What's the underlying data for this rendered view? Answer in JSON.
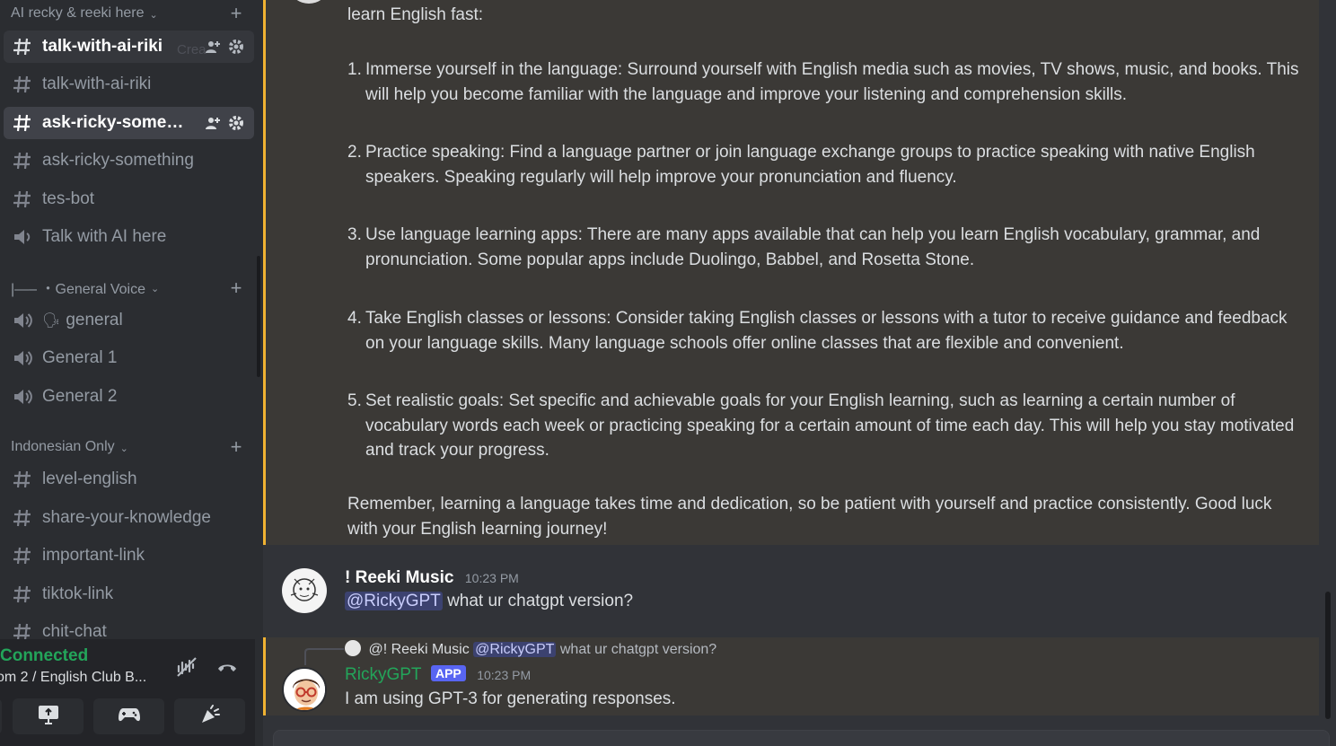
{
  "sidebar": {
    "category_ai": {
      "label": "AI recky & reeki here"
    },
    "ghost_text": "Crea",
    "channels_ai": [
      {
        "label": "talk-with-ai-riki",
        "icon": "text-channel-thread-icon"
      },
      {
        "label": "talk-with-ai-riki",
        "icon": "text-channel-icon"
      },
      {
        "label": "ask-ricky-somet...",
        "icon": "text-channel-thread-icon"
      },
      {
        "label": "ask-ricky-something",
        "icon": "text-channel-icon"
      },
      {
        "label": "tes-bot",
        "icon": "text-channel-thread-icon"
      },
      {
        "label": "Talk with AI here",
        "icon": "stage-channel-icon"
      }
    ],
    "category_voice": {
      "label": "|—– ・General Voice"
    },
    "channels_voice": [
      {
        "label": "general",
        "icon": "speaker-icon",
        "emoji": "🗣"
      },
      {
        "label": "General 1",
        "icon": "speaker-icon"
      },
      {
        "label": "General 2",
        "icon": "speaker-icon"
      }
    ],
    "category_indonesian": {
      "label": "Indonesian Only"
    },
    "channels_indonesian": [
      {
        "label": "level-english",
        "icon": "text-channel-thread-icon"
      },
      {
        "label": "share-your-knowledge",
        "icon": "text-channel-thread-icon"
      },
      {
        "label": "important-link",
        "icon": "text-channel-thread-icon"
      },
      {
        "label": "tiktok-link",
        "icon": "text-channel-icon"
      },
      {
        "label": "chit-chat",
        "icon": "text-channel-thread-icon"
      }
    ]
  },
  "voice_panel": {
    "status": "Connected",
    "room": "om 2 / English Club B..."
  },
  "messages": {
    "bot_reply": {
      "intro": "learn English fast:",
      "items": [
        {
          "n": "1.",
          "text": "Immerse yourself in the language: Surround yourself with English media such as movies, TV shows, music, and books. This will help you become familiar with the language and improve your listening and comprehension skills."
        },
        {
          "n": "2.",
          "text": "Practice speaking: Find a language partner or join language exchange groups to practice speaking with native English speakers. Speaking regularly will help improve your pronunciation and fluency."
        },
        {
          "n": "3.",
          "text": "Use language learning apps: There are many apps available that can help you learn English vocabulary, grammar, and pronunciation. Some popular apps include Duolingo, Babbel, and Rosetta Stone."
        },
        {
          "n": "4.",
          "text": "Take English classes or lessons: Consider taking English classes or lessons with a tutor to receive guidance and feedback on your language skills. Many language schools offer online classes that are flexible and convenient."
        },
        {
          "n": "5.",
          "text": "Set realistic goals: Set specific and achievable goals for your English learning, such as learning a certain number of vocabulary words each week or practicing speaking for a certain amount of time each day. This will help you stay motivated and track your progress."
        }
      ],
      "outro": "Remember, learning a language takes time and dedication, so be patient with yourself and practice consistently. Good luck with your English learning journey!"
    },
    "user_msg": {
      "author": "! Reeki Music",
      "time": "10:23 PM",
      "mention": "@RickyGPT",
      "text": "what ur chatgpt version?"
    },
    "bot_msg": {
      "reply_author": "@! Reeki Music",
      "reply_mention": "@RickyGPT",
      "reply_text": "what ur chatgpt version?",
      "author": "RickyGPT",
      "tag": "APP",
      "time": "10:23 PM",
      "text": "I am using GPT-3 for generating responses."
    }
  },
  "colors": {
    "sidebar_bg": "#2b2d31",
    "main_bg": "#313338",
    "highlight_bg": "#3b3936",
    "highlight_border": "#f0b232",
    "connected": "#23a55a",
    "bot_name": "#23a55a",
    "app_tag": "#5865f2"
  }
}
